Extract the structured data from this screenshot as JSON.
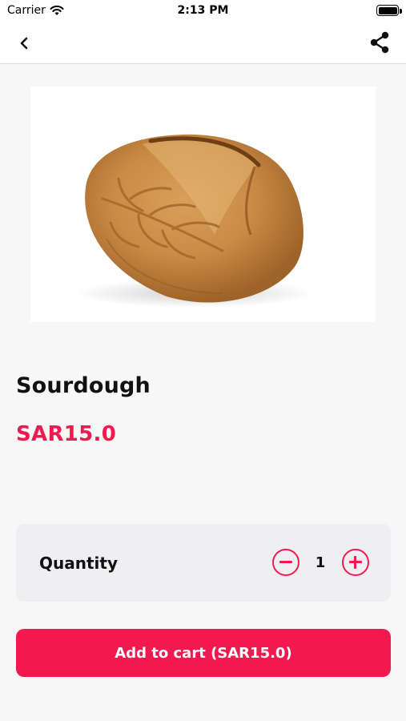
{
  "status_bar": {
    "carrier": "Carrier",
    "time": "2:13 PM",
    "icons": [
      "wifi-icon",
      "battery-icon"
    ]
  },
  "nav": {
    "back_icon": "chevron-left-icon",
    "share_icon": "share-icon"
  },
  "product": {
    "image_subject": "sourdough bread loaf",
    "name": "Sourdough",
    "price": "SAR15.0"
  },
  "quantity": {
    "label": "Quantity",
    "value": "1",
    "decrement_icon": "minus-circle-icon",
    "increment_icon": "plus-circle-icon"
  },
  "actions": {
    "add_to_cart_label": "Add to cart (SAR15.0)"
  },
  "colors": {
    "accent": "#f2194f",
    "background": "#f7f7f8",
    "card": "#efeff2"
  }
}
